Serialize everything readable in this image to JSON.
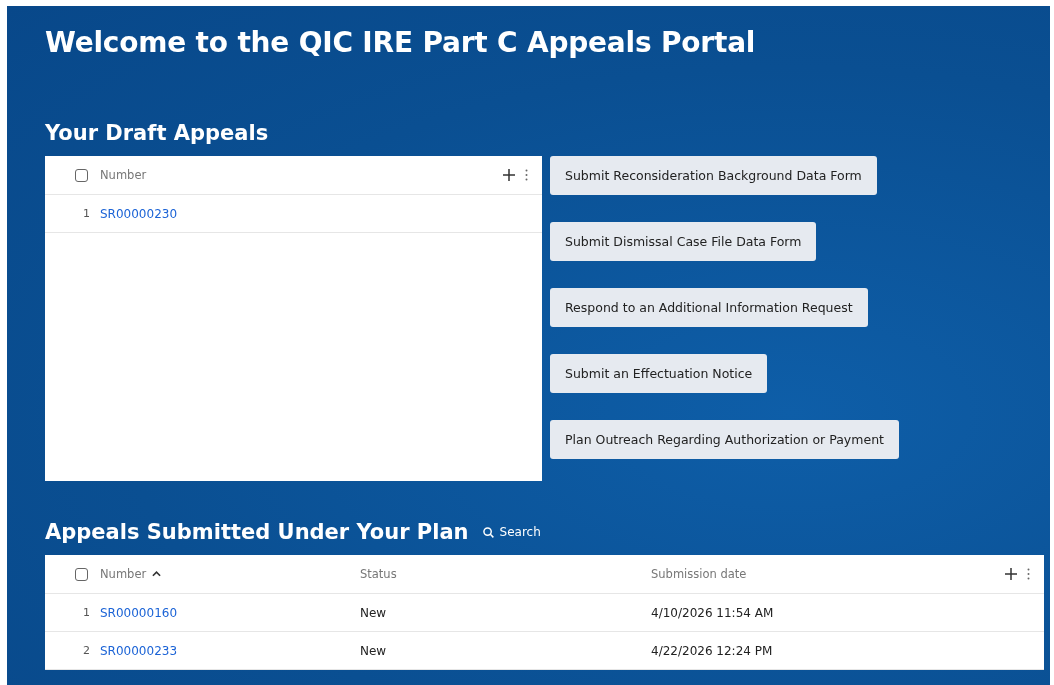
{
  "title": "Welcome to the QIC IRE Part C Appeals Portal",
  "draft_appeals": {
    "heading": "Your Draft Appeals",
    "table": {
      "select_all_checked": false,
      "columns": [
        {
          "label": "Number",
          "kind": "link",
          "sorted_ascending": false
        }
      ],
      "rows": [
        {
          "index": "1",
          "cells": [
            "SR00000230"
          ]
        }
      ]
    }
  },
  "actions": [
    "Submit Reconsideration Background Data Form",
    "Submit Dismissal Case File Data Form",
    "Respond to an Additional Information Request",
    "Submit an Effectuation Notice",
    "Plan Outreach Regarding Authorization or Payment"
  ],
  "submitted_appeals": {
    "heading": "Appeals Submitted Under Your Plan",
    "search_label": "Search",
    "table": {
      "select_all_checked": false,
      "columns": [
        {
          "label": "Number",
          "kind": "link",
          "sorted_ascending": true
        },
        {
          "label": "Status",
          "kind": "text",
          "sorted_ascending": false
        },
        {
          "label": "Submission date",
          "kind": "text",
          "sorted_ascending": false
        }
      ],
      "rows": [
        {
          "index": "1",
          "cells": [
            "SR00000160",
            "New",
            "4/10/2026 11:54 AM"
          ]
        },
        {
          "index": "2",
          "cells": [
            "SR00000233",
            "New",
            "4/22/2026 12:24 PM"
          ]
        }
      ]
    }
  }
}
